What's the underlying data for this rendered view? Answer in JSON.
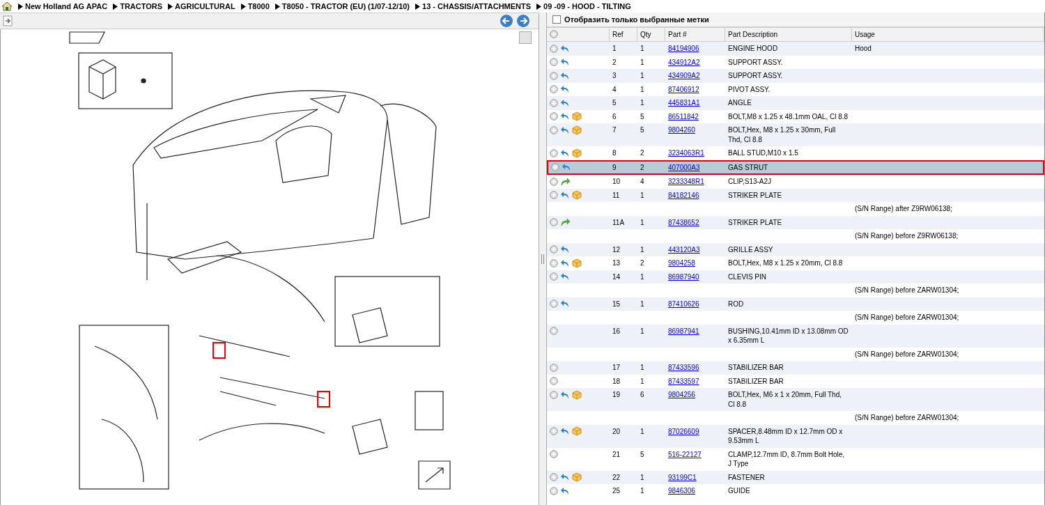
{
  "breadcrumb": [
    "New Holland AG APAC",
    "TRACTORS",
    "AGRICULTURAL",
    "T8000",
    "T8050 - TRACTOR (EU) (1/07-12/10)",
    "13 - CHASSIS/ATTACHMENTS",
    "09 -09 - HOOD - TILTING"
  ],
  "filter": {
    "label": "Отобразить только выбранные метки",
    "checked": false
  },
  "table": {
    "columns": [
      "Ref",
      "Qty",
      "Part #",
      "Part Description",
      "Usage"
    ],
    "rows": [
      {
        "ref": "1",
        "qty": "1",
        "part": "84194906",
        "description": "ENGINE HOOD",
        "usage": "Hood",
        "kind": "replaced",
        "kit": false,
        "selected": false
      },
      {
        "ref": "2",
        "qty": "1",
        "part": "434912A2",
        "description": "SUPPORT ASSY.",
        "kind": "replaced",
        "kit": false,
        "selected": false
      },
      {
        "ref": "3",
        "qty": "1",
        "part": "434909A2",
        "description": "SUPPORT ASSY.",
        "kind": "replaced",
        "kit": false,
        "selected": false
      },
      {
        "ref": "4",
        "qty": "1",
        "part": "87406912",
        "description": "PIVOT ASSY.",
        "kind": "replaced",
        "kit": false,
        "selected": false
      },
      {
        "ref": "5",
        "qty": "1",
        "part": "445831A1",
        "description": "ANGLE",
        "kind": "replaced",
        "kit": false,
        "selected": false
      },
      {
        "ref": "6",
        "qty": "5",
        "part": "86511842",
        "description": "BOLT,M8 x 1.25 x 48.1mm OAL, Cl 8.8",
        "kind": "replaced",
        "kit": true,
        "selected": false
      },
      {
        "ref": "7",
        "qty": "5",
        "part": "9804260",
        "description": "BOLT,Hex, M8 x 1.25 x 30mm, Full Thd, Cl 8.8",
        "kind": "replaced",
        "kit": true,
        "selected": false
      },
      {
        "ref": "8",
        "qty": "2",
        "part": "3234063R1",
        "description": "BALL STUD,M10 x 1.5",
        "kind": "replaced",
        "kit": true,
        "selected": false
      },
      {
        "ref": "9",
        "qty": "2",
        "part": "407000A3",
        "description": "GAS STRUT",
        "kind": "replaced",
        "kit": false,
        "selected": true
      },
      {
        "ref": "10",
        "qty": "4",
        "part": "3233348R1",
        "description": "CLIP,S13-A2J",
        "kind": "substitute",
        "kit": false,
        "selected": false
      },
      {
        "ref": "11",
        "qty": "1",
        "part": "84182146",
        "description": "STRIKER PLATE",
        "note": "(S/N Range) after Z9RW06138;",
        "kind": "replaced",
        "kit": true,
        "selected": false
      },
      {
        "ref": "11A",
        "qty": "1",
        "part": "87438652",
        "description": "STRIKER PLATE",
        "note": "(S/N Range) before Z9RW06138;",
        "kind": "substitute",
        "kit": false,
        "selected": false
      },
      {
        "ref": "12",
        "qty": "1",
        "part": "443120A3",
        "description": "GRILLE ASSY",
        "kind": "replaced",
        "kit": false,
        "selected": false
      },
      {
        "ref": "13",
        "qty": "2",
        "part": "9804258",
        "description": "BOLT,Hex, M8 x 1.25 x 20mm, Cl 8.8",
        "kind": "replaced",
        "kit": true,
        "selected": false
      },
      {
        "ref": "14",
        "qty": "1",
        "part": "86987940",
        "description": "CLEVIS PIN",
        "note": "(S/N Range) before ZARW01304;",
        "kind": "replaced",
        "kit": false,
        "selected": false
      },
      {
        "ref": "15",
        "qty": "1",
        "part": "87410626",
        "description": "ROD",
        "note": "(S/N Range) before ZARW01304;",
        "kind": "replaced",
        "kit": false,
        "selected": false
      },
      {
        "ref": "16",
        "qty": "1",
        "part": "86987941",
        "description": "BUSHING,10.41mm ID x 13.08mm OD x 6.35mm L",
        "note": "(S/N Range) before ZARW01304;",
        "kind": "plain",
        "kit": false,
        "selected": false
      },
      {
        "ref": "17",
        "qty": "1",
        "part": "87433596",
        "description": "STABILIZER BAR",
        "kind": "plain",
        "kit": false,
        "selected": false
      },
      {
        "ref": "18",
        "qty": "1",
        "part": "87433597",
        "description": "STABILIZER BAR",
        "kind": "plain",
        "kit": false,
        "selected": false
      },
      {
        "ref": "19",
        "qty": "6",
        "part": "9804256",
        "description": "BOLT,Hex, M6 x 1 x 20mm, Full Thd, Cl 8.8",
        "note": "(S/N Range) before ZARW01304;",
        "kind": "replaced",
        "kit": true,
        "selected": false
      },
      {
        "ref": "20",
        "qty": "1",
        "part": "87026609",
        "description": "SPACER,8.48mm ID x 12.7mm OD x 9.53mm L",
        "kind": "replaced",
        "kit": true,
        "selected": false
      },
      {
        "ref": "21",
        "qty": "5",
        "part": "516-22127",
        "description": "CLAMP,12.7mm ID, 8.7mm Bolt Hole, J Type",
        "kind": "plain",
        "kit": false,
        "selected": false
      },
      {
        "ref": "22",
        "qty": "1",
        "part": "93199C1",
        "description": "FASTENER",
        "kind": "replaced",
        "kit": true,
        "selected": false
      },
      {
        "ref": "25",
        "qty": "1",
        "part": "9846306",
        "description": "GUIDE",
        "kind": "replaced",
        "kit": false,
        "selected": false
      }
    ]
  }
}
